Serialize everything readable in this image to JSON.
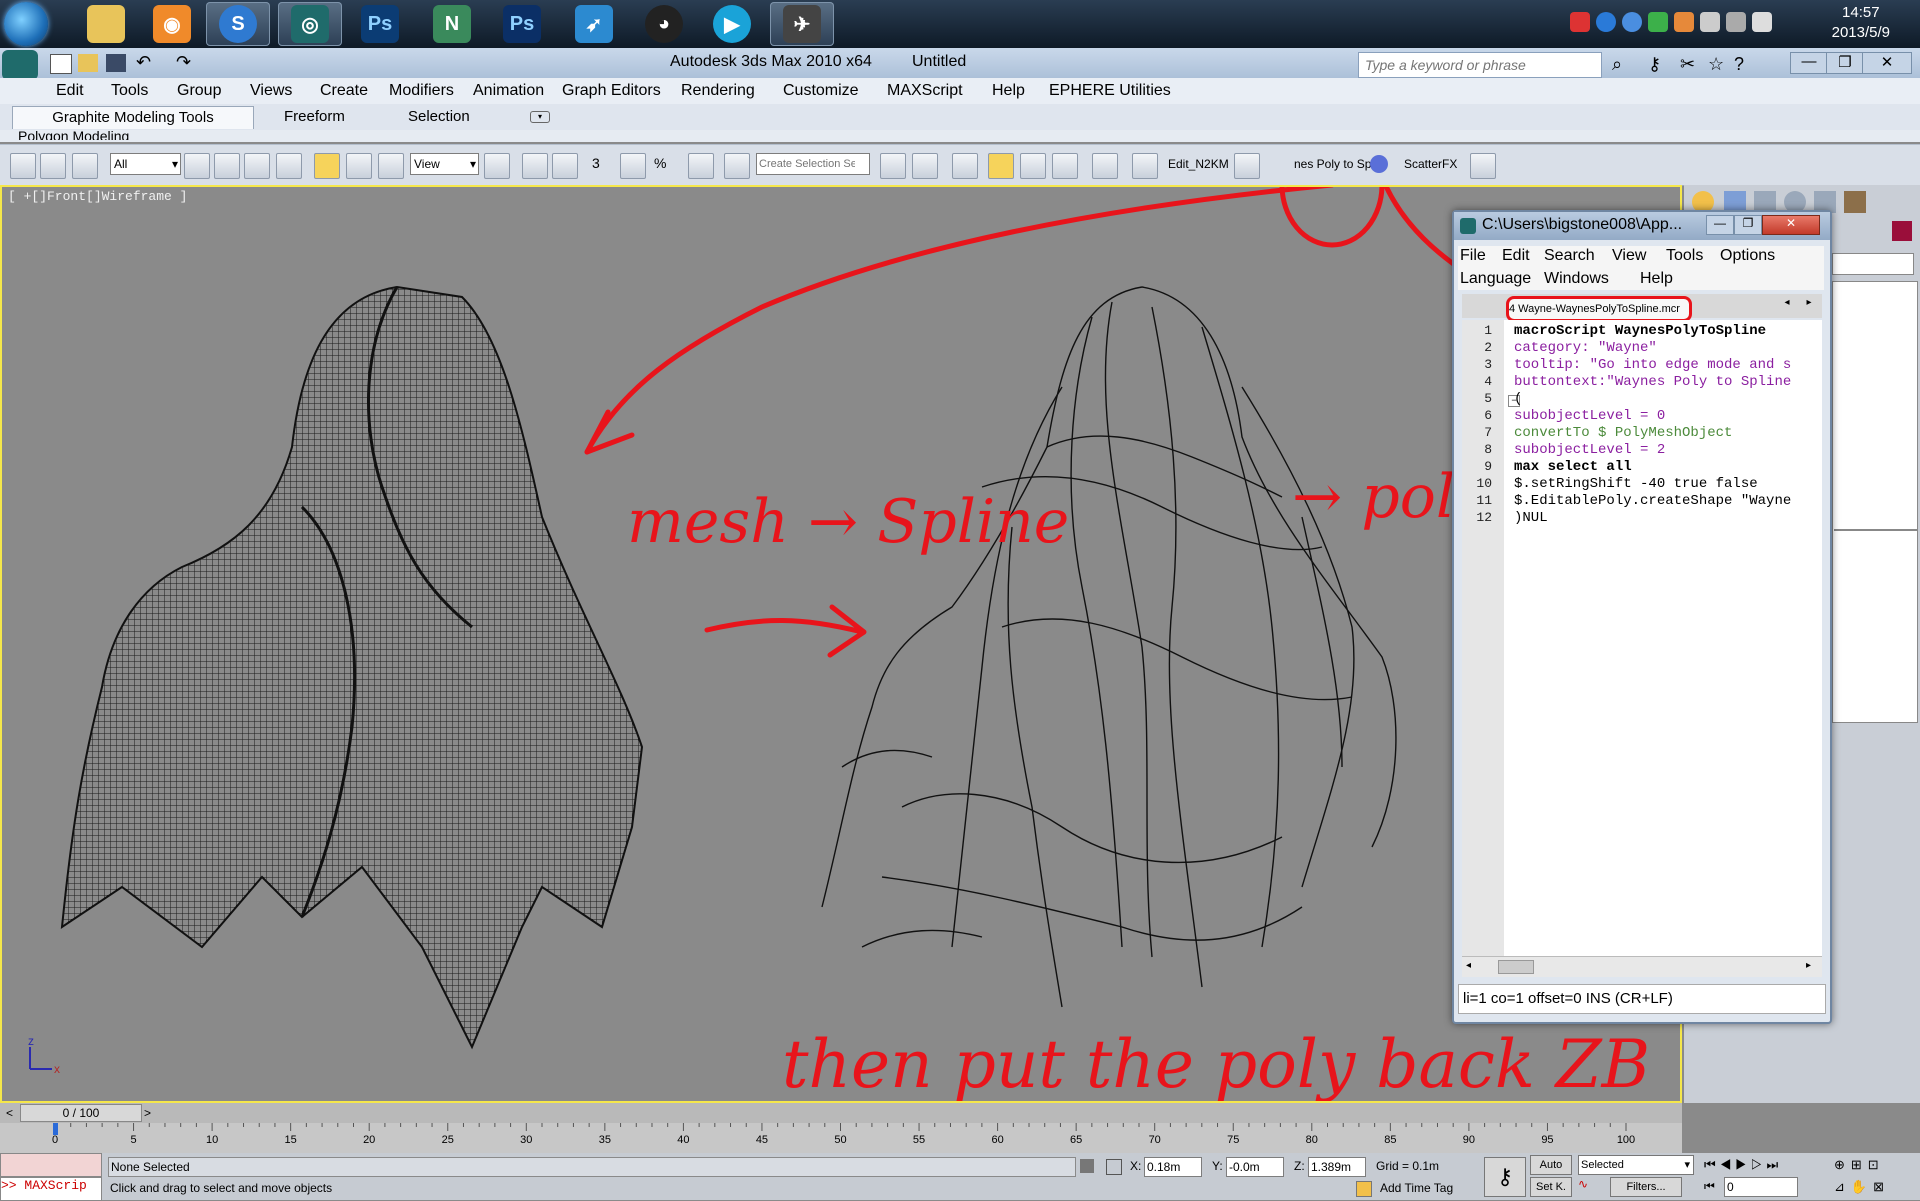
{
  "taskbar": {
    "clock_time": "14:57",
    "clock_date": "2013/5/9"
  },
  "app": {
    "title": "Autodesk 3ds Max  2010 x64",
    "document": "Untitled",
    "search_placeholder": "Type a keyword or phrase"
  },
  "menu": [
    "Edit",
    "Tools",
    "Group",
    "Views",
    "Create",
    "Modifiers",
    "Animation",
    "Graph Editors",
    "Rendering",
    "Customize",
    "MAXScript",
    "Help",
    "EPHERE Utilities"
  ],
  "ribbon": {
    "tabs": [
      "Graphite Modeling Tools",
      "Freeform",
      "Selection"
    ],
    "subtab": "Polygon Modeling"
  },
  "toolbar": {
    "filter_value": "All",
    "refcoord_value": "View",
    "selection_set_placeholder": "Create Selection Se",
    "btn_edit_n2km": "Edit_N2KM",
    "btn_poly_to_spline": "nes Poly to Sp",
    "btn_scatterfx": "ScatterFX",
    "snap_num": "3",
    "percent": "%"
  },
  "viewport": {
    "label": "[ +[]Front[]Wireframe ]",
    "annotations": {
      "mesh_spline": "mesh → Spline",
      "arrow_poly": "→ poly",
      "bottom": "then put the poly back ZB"
    },
    "axis_z": "z",
    "axis_x": "x"
  },
  "editor": {
    "title": "C:\\Users\\bigstone008\\App...",
    "menu_row1": [
      "File",
      "Edit",
      "Search",
      "View",
      "Tools",
      "Options"
    ],
    "menu_row2": [
      "Language",
      "Windows",
      "Help"
    ],
    "tab": "4 Wayne-WaynesPolyToSpline.mcr",
    "code": [
      "macroScript WaynesPolyToSpline",
      "category: \"Wayne\"",
      "tooltip: \"Go into edge mode and s",
      "buttontext:\"Waynes Poly to Spline",
      "(",
      "subobjectLevel = 0",
      "convertTo $ PolyMeshObject",
      "subobjectLevel = 2",
      "max select all",
      "$.setRingShift -40 true false",
      "$.EditablePoly.createShape \"Wayne",
      ")NUL"
    ],
    "line_numbers": [
      "1",
      "2",
      "3",
      "4",
      "5",
      "6",
      "7",
      "8",
      "9",
      "10",
      "11",
      "12"
    ],
    "status": "li=1 co=1 offset=0 INS (CR+LF)"
  },
  "timeline": {
    "frame_counter": "0 / 100",
    "ticks": [
      "0",
      "5",
      "10",
      "15",
      "20",
      "25",
      "30",
      "35",
      "40",
      "45",
      "50",
      "55",
      "60",
      "65",
      "70",
      "75",
      "80",
      "85",
      "90",
      "95",
      "100"
    ]
  },
  "status": {
    "maxscript_label": ">> MAXScrip",
    "selection": "None Selected",
    "prompt": "Click and drag to select and move objects",
    "x_label": "X:",
    "x_value": "0.18m",
    "y_label": "Y:",
    "y_value": "-0.0m",
    "z_label": "Z:",
    "z_value": "1.389m",
    "grid": "Grid = 0.1m",
    "add_time_tag": "Add Time Tag",
    "auto": "Auto",
    "set_key": "Set K.",
    "selected": "Selected",
    "filters": "Filters...",
    "frame_value": "0"
  },
  "colors": {
    "annotation_red": "#e8141b",
    "viewport_bg": "#8a8a8a",
    "active_border": "#f5e74a"
  }
}
